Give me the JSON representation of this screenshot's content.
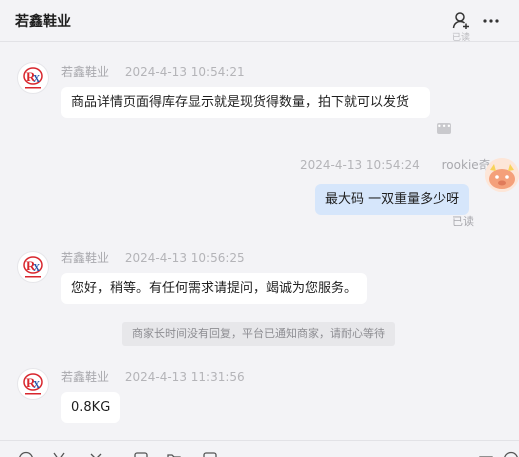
{
  "header": {
    "title": "若鑫鞋业",
    "read_peek": "已读"
  },
  "messages": [
    {
      "sender": "若鑫鞋业",
      "time": "2024-4-13 10:54:21",
      "text": "商品详情页面得库存显示就是现货得数量，拍下就可以发货",
      "ellipsis": "•••"
    },
    {
      "sender": "rookie奇",
      "time": "2024-4-13 10:54:24",
      "text": "最大码  一双重量多少呀",
      "status": "已读"
    },
    {
      "sender": "若鑫鞋业",
      "time": "2024-4-13 10:56:25",
      "text": "您好，稍等。有任何需求请提问，竭诚为您服务。"
    },
    {
      "sender": "若鑫鞋业",
      "time": "2024-4-13 11:31:56",
      "text": "0.8KG"
    }
  ],
  "system_notice": "商家长时间没有回复，平台已通知商家，请耐心等待",
  "brand_logo_text": "RX",
  "colors": {
    "background": "#f3f3f6",
    "bubble_incoming": "#ffffff",
    "bubble_outgoing": "#d6e6fb",
    "logo_red": "#d8262d"
  }
}
